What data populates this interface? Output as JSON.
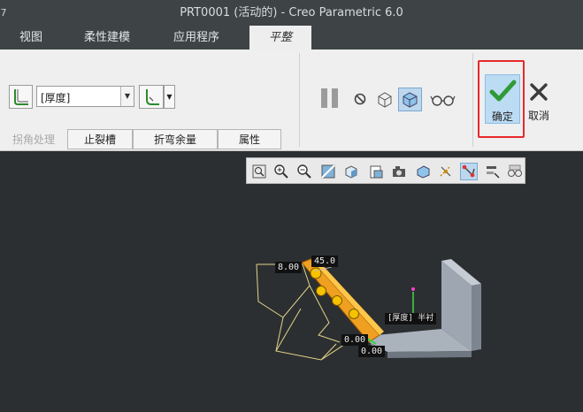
{
  "window": {
    "title": "PRT0001 (活动的) - Creo Parametric 6.0",
    "menu_arrow": "7"
  },
  "tabs": [
    {
      "label": "视图",
      "active": false
    },
    {
      "label": "柔性建模",
      "active": false
    },
    {
      "label": "应用程序",
      "active": false
    },
    {
      "label": "平整",
      "active": true
    }
  ],
  "ribbon": {
    "relief_type": {
      "value": "[厚度]"
    },
    "subtabs": [
      {
        "label": "拐角处理",
        "disabled": true
      },
      {
        "label": "止裂槽",
        "disabled": false
      },
      {
        "label": "折弯余量",
        "disabled": false
      },
      {
        "label": "属性",
        "disabled": false
      }
    ],
    "confirm_label": "确定",
    "cancel_label": "取消"
  },
  "viewport": {
    "dimensions": [
      {
        "text": "8.00"
      },
      {
        "text": "45.0"
      },
      {
        "text": "0.00"
      },
      {
        "text": "0.00"
      }
    ],
    "relief_tag": "[厚度] 半衬"
  },
  "colors": {
    "viewport_bg": "#2c2f31",
    "flange": "#f0a020",
    "handle": "#f6c200",
    "part": "#9ea6b1",
    "confirm_frame": "#e8292b",
    "confirm_bg": "#bcdcf4"
  }
}
